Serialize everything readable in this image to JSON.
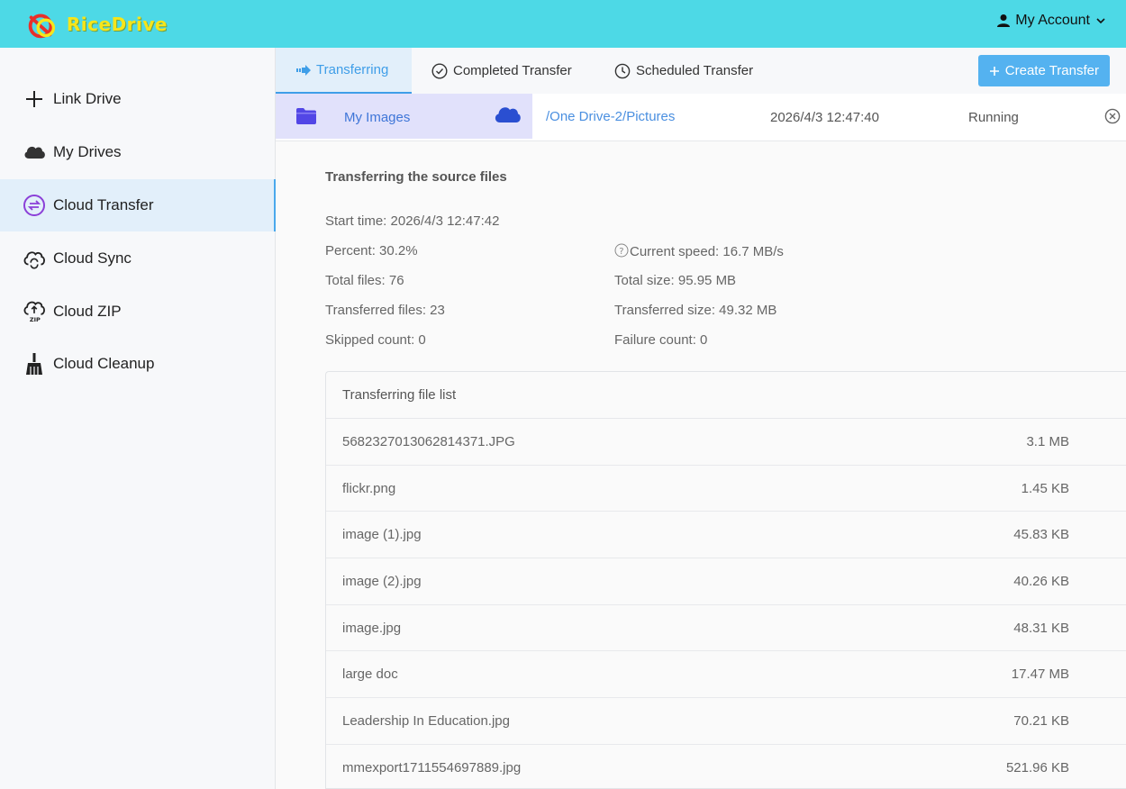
{
  "header": {
    "brand": "RiceDrive",
    "account_label": "My Account",
    "colors": {
      "header_bg": "#4dd9e6",
      "accent": "#3f9ee8"
    }
  },
  "sidebar": {
    "items": [
      {
        "label": "Link Drive",
        "icon": "plus-icon"
      },
      {
        "label": "My Drives",
        "icon": "cloud-icon"
      },
      {
        "label": "Cloud Transfer",
        "icon": "transfer-icon",
        "active": true
      },
      {
        "label": "Cloud Sync",
        "icon": "cloud-sync-icon"
      },
      {
        "label": "Cloud ZIP",
        "icon": "cloud-zip-icon"
      },
      {
        "label": "Cloud Cleanup",
        "icon": "broom-icon"
      }
    ]
  },
  "tabs": {
    "items": [
      {
        "label": "Transferring",
        "icon": "arrow-right-icon",
        "active": true
      },
      {
        "label": "Completed Transfer",
        "icon": "check-circle-icon"
      },
      {
        "label": "Scheduled Transfer",
        "icon": "clock-icon"
      }
    ],
    "create_button": "Create Transfer"
  },
  "task": {
    "source": "My Images",
    "destination": "/One Drive-2/Pictures",
    "created": "2026/4/3 12:47:40",
    "status": "Running",
    "progress_fraction": 0.302
  },
  "details": {
    "title": "Transferring the source files",
    "start_time": "Start time: 2026/4/3 12:47:42",
    "percent": "Percent: 30.2%",
    "current_speed": "Current speed: 16.7 MB/s",
    "total_files": "Total files: 76",
    "total_size": "Total size: 95.95 MB",
    "transferred_files": "Transferred files: 23",
    "transferred_size": "Transferred size: 49.32 MB",
    "skipped_count": "Skipped count: 0",
    "failure_count": "Failure count: 0"
  },
  "file_list": {
    "title": "Transferring file list",
    "rows": [
      {
        "name": "5682327013062814371.JPG",
        "size": "3.1 MB"
      },
      {
        "name": "flickr.png",
        "size": "1.45 KB"
      },
      {
        "name": "image (1).jpg",
        "size": "45.83 KB"
      },
      {
        "name": "image (2).jpg",
        "size": "40.26 KB"
      },
      {
        "name": "image.jpg",
        "size": "48.31 KB"
      },
      {
        "name": "large doc",
        "size": "17.47 MB"
      },
      {
        "name": "Leadership In Education.jpg",
        "size": "70.21 KB"
      },
      {
        "name": "mmexport1711554697889.jpg",
        "size": "521.96 KB"
      }
    ]
  }
}
